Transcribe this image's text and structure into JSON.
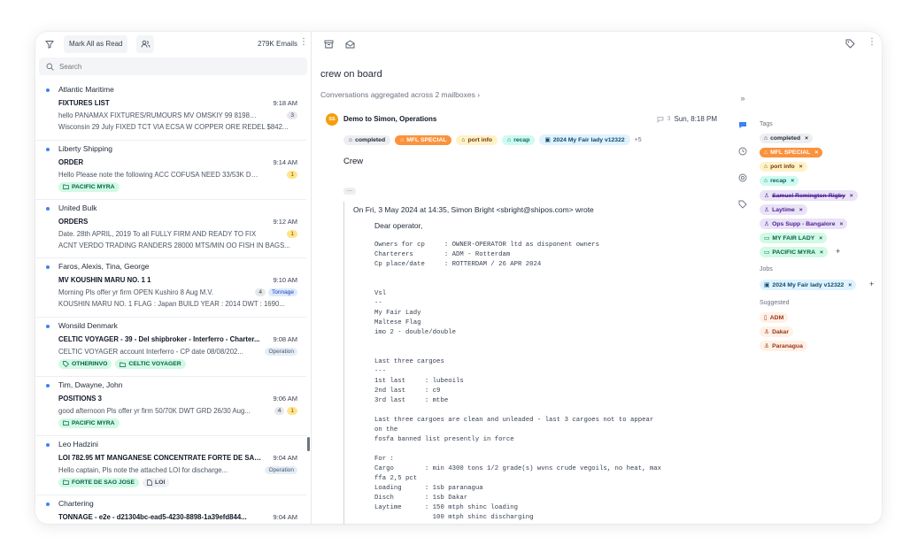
{
  "toolbar": {
    "mark_read_label": "Mark All as Read",
    "email_count": "279K Emails"
  },
  "search": {
    "placeholder": "Search"
  },
  "emails": [
    {
      "from": "Atlantic Maritime",
      "subject": "FIXTURES LIST",
      "time": "9:18 AM",
      "preview1": "hello PANAMAX FIXTURES/RUMOURS MV OMSKIY 99 81982/22",
      "preview2": "Wisconsin 29 July FIXED TCT VIA ECSA W COPPER ORE REDEL $842...",
      "badge": "3"
    },
    {
      "from": "Liberty Shipping",
      "subject": "ORDER",
      "time": "9:14 AM",
      "preview1": "Hello Please note the following ACC COFUSA NEED 33/53K DWC...",
      "badge": "1",
      "tags": [
        "PACIFIC MYRA"
      ]
    },
    {
      "from": "United Bulk",
      "subject": "ORDERS",
      "time": "9:12 AM",
      "preview1": "Date. 28th APRIL, 2019 To all FULLY FIRM AND READY TO FIX",
      "preview2": "ACNT VERDO TRADING RANDERS 28000 MTS/MIN OO FISH IN BAGS...",
      "badge": "1"
    },
    {
      "from": "Faros, Alexis, Tina, George",
      "subject": "MV KOUSHIN MARU NO. 1 1",
      "time": "9:10 AM",
      "preview1": "Morning Pls offer yr firm OPEN Kushiro 8 Aug M.V.",
      "preview2": "KOUSHIN MARU NO. 1 FLAG : Japan BUILD YEAR : 2014 DWT : 1690...",
      "badge": "4",
      "label": "Tonnage"
    },
    {
      "from": "Wonsild Denmark",
      "subject": "CELTIC VOYAGER - 39 - Del shipbroker - Interferro - Charter...",
      "time": "9:08 AM",
      "preview1": "CELTIC VOYAGER account Interferro - CP date 08/08/202...",
      "label": "Operation",
      "tags": [
        "OTHERINVO",
        "CELTIC VOYAGER"
      ]
    },
    {
      "from": "Tim, Dwayne, John",
      "subject": "POSITIONS 3",
      "time": "9:06 AM",
      "preview1": "good afternoon Pls offer yr firm 50/70K DWT GRD 26/30 Aug...",
      "badge": "4",
      "badge2": "1",
      "tags": [
        "PACIFIC MYRA"
      ]
    },
    {
      "from": "Leo Hadzini",
      "subject": "LOI 782.95 MT MANGANESE CONCENTRATE FORTE DE SAO...",
      "time": "9:04 AM",
      "preview1": "Hello captain, Pls note the attached LOI for discharge...",
      "label": "Operation",
      "tags": [
        "FORTE DE SAO JOSE",
        "LOI"
      ]
    },
    {
      "from": "Chartering",
      "subject": "TONNAGE - e2e - d21304bc-ead5-4230-8898-1a39efd844...",
      "time": "9:04 AM"
    }
  ],
  "thread": {
    "title": "crew on board",
    "aggregated": "Conversations aggregated across 2 mailboxes",
    "avatar": "SS",
    "from": "Demo to Simon, Operations",
    "reply_count": "3",
    "time": "Sun, 8:18 PM",
    "tags": [
      "completed",
      "MFL SPECIAL",
      "port info",
      "recap",
      "2024 My Fair lady v12322"
    ],
    "more_tags": "+5",
    "first_line": "Crew",
    "ellipsis": "...",
    "quote_header": "On Fri, 3 May 2024 at 14:35, Simon Bright <sbright@shipos.com> wrote",
    "greeting": "Dear operator,",
    "body": "Owners for cp     : OWNER-OPERATOR ltd as disponent owners\nCharterers        : ADM - Rotterdam\nCp place/date     : ROTTERDAM / 26 APR 2024\n\n\nVsl\n--\nMy Fair Lady\nMaltese Flag\nimo 2 - double/double\n\n\nLast three cargoes\n---\n1st last     : lubeoils\n2nd last     : c9\n3rd last     : mtbe\n\nLast three cargoes are clean and unleaded - last 3 cargoes not to appear\non the\nfosfa banned list presently in force\n\nFor :\nCargo        : min 4300 tons 1/2 grade(s) wvns crude vegoils, no heat, max\nffa 2,5 pct\nLoading      : 1sb paranagua\nDisch        : 1sb Dakar\nLaytime      : 150 mtph shinc loading\n               100 mtph shinc discharging"
  },
  "sidebar": {
    "tags_label": "Tags",
    "tags": [
      "completed",
      "MFL SPECIAL",
      "port info",
      "recap",
      "Samuel Remington-Rigby",
      "Laytime",
      "Ops Supp - Bangalore",
      "MY FAIR LADY",
      "PACIFIC MYRA"
    ],
    "jobs_label": "Jobs",
    "jobs": [
      "2024 My Fair lady v12322"
    ],
    "suggested_label": "Suggested",
    "suggested": [
      "ADM",
      "Dakar",
      "Paranagua"
    ],
    "remove_glyph": "×",
    "add_glyph": "+"
  },
  "colors": {
    "accent_blue": "#3b82f6",
    "orange_tag": "#fb923c",
    "green_tag": "#d1fae5"
  }
}
